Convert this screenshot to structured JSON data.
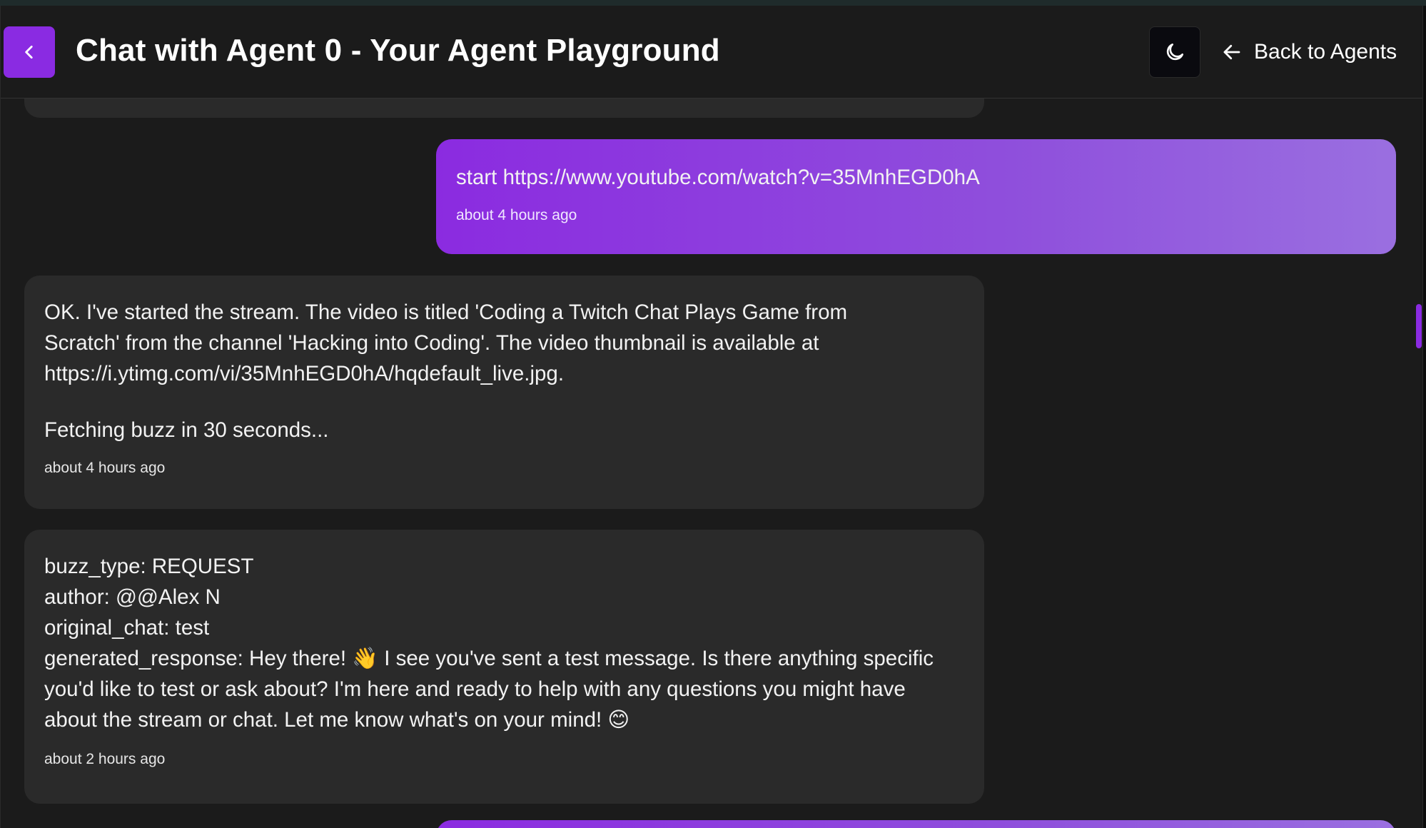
{
  "header": {
    "title": "Chat with Agent 0 - Your Agent Playground",
    "back_link_label": "Back to Agents",
    "icons": {
      "back": "chevron-left-icon",
      "theme": "moon-icon",
      "back_link": "arrow-left-icon"
    }
  },
  "colors": {
    "accent": "#8a2be2",
    "background": "#1b1b1b",
    "agent_bubble": "#2a2a2a"
  },
  "messages": [
    {
      "role": "user",
      "text": "start https://www.youtube.com/watch?v=35MnhEGD0hA",
      "time": "about 4 hours ago"
    },
    {
      "role": "agent",
      "text": "OK. I've started the stream. The video is titled 'Coding a Twitch Chat Plays Game from\nScratch' from the channel 'Hacking into Coding'. The video thumbnail is available at\nhttps://i.ytimg.com/vi/35MnhEGD0hA/hqdefault_live.jpg.",
      "text2": "Fetching buzz in 30 seconds...",
      "time": "about 4 hours ago"
    },
    {
      "role": "agent",
      "text": "buzz_type: REQUEST\nauthor: @@Alex N\noriginal_chat: test\ngenerated_response: Hey there! 👋 I see you've sent a test message. Is there anything specific\nyou'd like to test or ask about? I'm here and ready to help with any questions you might have\nabout the stream or chat. Let me know what's on your mind! 😊",
      "time": "about 2 hours ago"
    }
  ]
}
